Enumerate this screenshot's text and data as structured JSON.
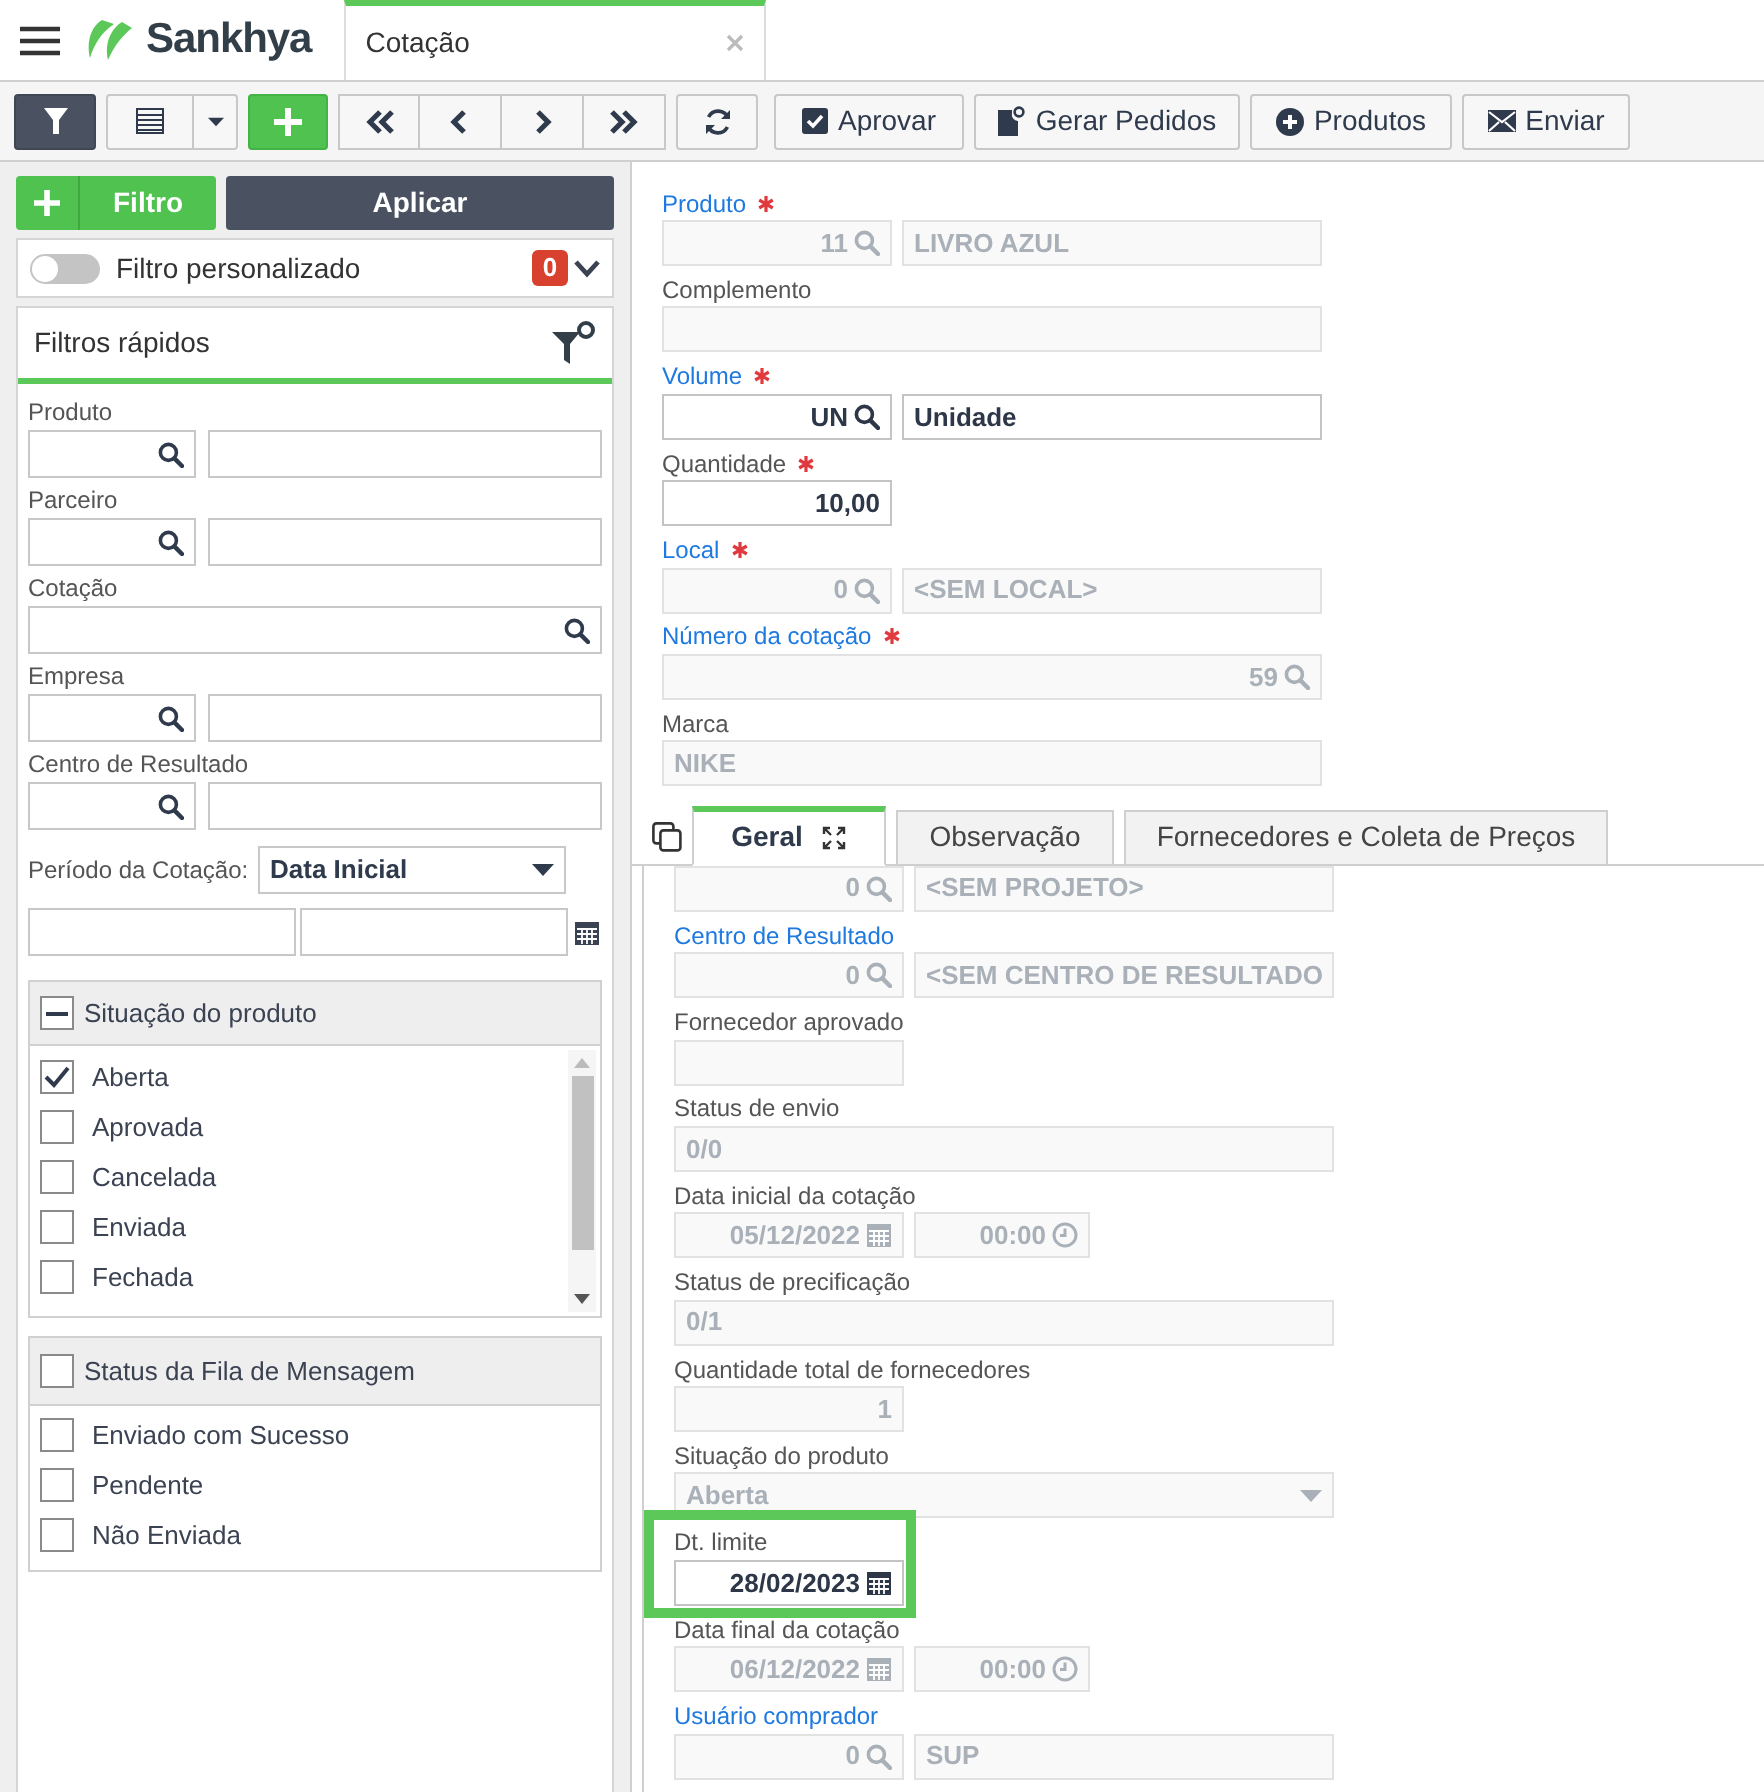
{
  "header": {
    "brand": "Sankhya",
    "tab": {
      "title": "Cotação",
      "selected": true
    }
  },
  "toolbar": {
    "filter_button": {
      "selected": true
    },
    "actions": [
      {
        "label": "Aprovar"
      },
      {
        "label": "Gerar Pedidos"
      },
      {
        "label": "Produtos"
      },
      {
        "label": "Enviar"
      }
    ]
  },
  "filter_panel": {
    "add_label": "Filtro",
    "apply_label": "Aplicar",
    "custom_filter": {
      "label": "Filtro personalizado",
      "on": false,
      "count": "0"
    },
    "quick_filters": {
      "title": "Filtros rápidos",
      "fields": [
        {
          "kind": "lookup",
          "label": "Produto"
        },
        {
          "kind": "lookup",
          "label": "Parceiro"
        },
        {
          "kind": "search",
          "label": "Cotação"
        },
        {
          "kind": "lookup",
          "label": "Empresa"
        },
        {
          "kind": "lookup",
          "label": "Centro de Resultado"
        }
      ],
      "period": {
        "label": "Período da Cotação:",
        "value": "Data Inicial"
      },
      "groups": [
        {
          "kind": "scroll_list",
          "title": "Situação do produto",
          "indeterminate": true,
          "items": [
            {
              "label": "Aberta",
              "checked": true
            },
            {
              "label": "Aprovada",
              "checked": false
            },
            {
              "label": "Cancelada",
              "checked": false
            },
            {
              "label": "Enviada",
              "checked": false
            },
            {
              "label": "Fechada",
              "checked": false
            }
          ]
        },
        {
          "kind": "list",
          "title": "Status da Fila de Mensagem",
          "indeterminate": false,
          "items": [
            {
              "label": "Enviado com Sucesso",
              "checked": false
            },
            {
              "label": "Pendente",
              "checked": false
            },
            {
              "label": "Não Enviada",
              "checked": false
            }
          ]
        }
      ]
    }
  },
  "form": {
    "fields": [
      {
        "kind": "lookup",
        "label": "Produto",
        "link": true,
        "required": true,
        "code": "11",
        "description": "LIVRO AZUL",
        "disabled": true
      },
      {
        "kind": "text",
        "label": "Complemento",
        "link": false,
        "required": false,
        "disabled": true
      },
      {
        "kind": "lookup",
        "label": "Volume",
        "link": true,
        "required": true,
        "code": "UN",
        "description": "Unidade",
        "disabled": false
      },
      {
        "kind": "number",
        "label": "Quantidade",
        "link": false,
        "required": true,
        "value": "10,00",
        "disabled": false
      },
      {
        "kind": "lookup",
        "label": "Local",
        "link": true,
        "required": true,
        "code": "0",
        "description": "<SEM LOCAL>",
        "disabled": true
      },
      {
        "kind": "search_wide",
        "label": "Número da cotação",
        "link": true,
        "required": true,
        "value": "59",
        "disabled": true
      },
      {
        "kind": "text",
        "label": "Marca",
        "link": false,
        "required": false,
        "value": "NIKE",
        "disabled": true
      }
    ]
  },
  "tabs": [
    {
      "label": "Geral",
      "selected": true
    },
    {
      "label": "Observação",
      "selected": false
    },
    {
      "label": "Fornecedores e Coleta de Preços",
      "selected": false
    }
  ],
  "tab_fields": [
    {
      "kind": "lookup",
      "code": "0",
      "description": "<SEM PROJETO>",
      "disabled": true
    },
    {
      "kind": "lookup",
      "label": "Centro de Resultado",
      "link": true,
      "required": false,
      "code": "0",
      "description": "<SEM CENTRO DE RESULTADO",
      "disabled": true
    },
    {
      "kind": "short",
      "label": "Fornecedor aprovado",
      "link": false,
      "required": false,
      "disabled": true
    },
    {
      "kind": "text",
      "label": "Status de envio",
      "link": false,
      "required": false,
      "value": "0/0",
      "disabled": true
    },
    {
      "kind": "date_time",
      "label": "Data inicial da cotação",
      "link": false,
      "required": false,
      "date": "05/12/2022",
      "time": "00:00",
      "disabled": true
    },
    {
      "kind": "text",
      "label": "Status de precificação",
      "link": false,
      "required": false,
      "value": "0/1",
      "disabled": true
    },
    {
      "kind": "short",
      "label": "Quantidade total de fornecedores",
      "link": false,
      "required": false,
      "value": "1",
      "disabled": true
    },
    {
      "kind": "select",
      "label": "Situação do produto",
      "link": false,
      "required": false,
      "value": "Aberta",
      "disabled": true
    },
    {
      "kind": "date",
      "label": "Dt. limite",
      "link": false,
      "required": false,
      "value": "28/02/2023",
      "disabled": false,
      "highlighted": true
    },
    {
      "kind": "date_time",
      "label": "Data final da cotação",
      "link": false,
      "required": false,
      "date": "06/12/2022",
      "time": "00:00",
      "disabled": true
    },
    {
      "kind": "lookup",
      "label": "Usuário comprador",
      "link": true,
      "required": false,
      "code": "0",
      "description": "SUP",
      "disabled": true
    }
  ]
}
